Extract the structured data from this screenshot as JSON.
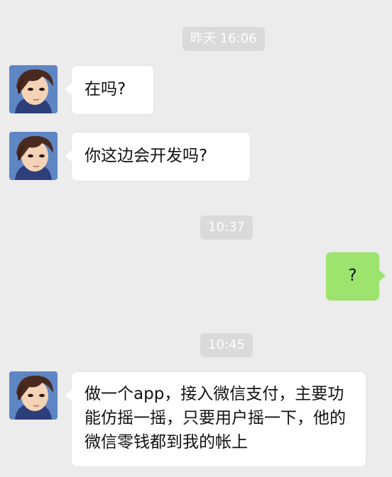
{
  "chat": {
    "timestamps": [
      "昨天 16:06",
      "10:37",
      "10:45"
    ],
    "messages": [
      {
        "sender": "contact",
        "text": "在吗?"
      },
      {
        "sender": "contact",
        "text": "你这边会开发吗?"
      },
      {
        "sender": "me",
        "text": "?"
      },
      {
        "sender": "contact",
        "text": "做一个app，接入微信支付，主要功能仿摇一摇，只要用户摇一下，他的微信零钱都到我的帐上"
      }
    ]
  },
  "colors": {
    "background": "#ececec",
    "incoming_bubble": "#ffffff",
    "outgoing_bubble": "#9ce46d",
    "timestamp_pill": "#dadada"
  },
  "icons": {
    "avatar": "anime-avatar-icon"
  }
}
